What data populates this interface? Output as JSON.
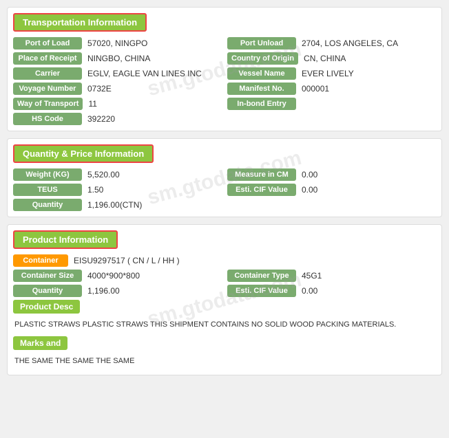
{
  "transport": {
    "header": "Transportation Information",
    "fields": {
      "port_of_load_label": "Port of Load",
      "port_of_load_value": "57020, NINGPO",
      "port_of_unload_label": "Port Unload",
      "port_of_unload_value": "2704, LOS ANGELES, CA",
      "place_of_receipt_label": "Place of Receipt",
      "place_of_receipt_value": "NINGBO, CHINA",
      "country_of_origin_label": "Country of Origin",
      "country_of_origin_value": "CN, CHINA",
      "carrier_label": "Carrier",
      "carrier_value": "EGLV, EAGLE VAN LINES INC",
      "vessel_name_label": "Vessel Name",
      "vessel_name_value": "EVER LIVELY",
      "voyage_number_label": "Voyage Number",
      "voyage_number_value": "0732E",
      "manifest_no_label": "Manifest No.",
      "manifest_no_value": "000001",
      "way_of_transport_label": "Way of Transport",
      "way_of_transport_value": "11",
      "in_bond_entry_label": "In-bond Entry",
      "in_bond_entry_value": "",
      "hs_code_label": "HS Code",
      "hs_code_value": "392220"
    }
  },
  "quantity_price": {
    "header": "Quantity & Price Information",
    "fields": {
      "weight_label": "Weight (KG)",
      "weight_value": "5,520.00",
      "measure_in_cm_label": "Measure in CM",
      "measure_in_cm_value": "0.00",
      "teus_label": "TEUS",
      "teus_value": "1.50",
      "esti_cif_value_label": "Esti. CIF Value",
      "esti_cif_value_value": "0.00",
      "quantity_label": "Quantity",
      "quantity_value": "1,196.00(CTN)"
    }
  },
  "product": {
    "header": "Product Information",
    "container_label": "Container",
    "container_value": "EISU9297517 ( CN / L / HH )",
    "container_size_label": "Container Size",
    "container_size_value": "4000*900*800",
    "container_type_label": "Container Type",
    "container_type_value": "45G1",
    "quantity_label": "Quantity",
    "quantity_value": "1,196.00",
    "esti_cif_label": "Esti. CIF Value",
    "esti_cif_value": "0.00",
    "product_desc_header": "Product Desc",
    "product_desc_text": "PLASTIC STRAWS PLASTIC STRAWS THIS SHIPMENT CONTAINS NO SOLID WOOD PACKING MATERIALS.",
    "marks_header": "Marks and",
    "marks_text": "THE SAME THE SAME THE SAME"
  },
  "watermark": "sm.gtodata.com"
}
